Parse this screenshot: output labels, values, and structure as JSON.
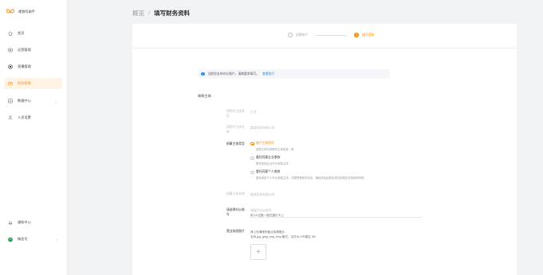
{
  "sidebar": {
    "brand": "视频号助手",
    "items": [
      {
        "label": "首页",
        "icon": "home-icon"
      },
      {
        "label": "运营管理",
        "icon": "ops-icon"
      },
      {
        "label": "直播管理",
        "icon": "live-icon"
      },
      {
        "label": "财务管理",
        "icon": "finance-icon",
        "active": true
      },
      {
        "label": "数据中心",
        "icon": "chart-icon",
        "arrow": "⌄"
      },
      {
        "label": "人员设置",
        "icon": "user-icon"
      }
    ],
    "bottom": [
      {
        "label": "通知中心",
        "icon": "bell-icon"
      },
      {
        "label": "微信号",
        "icon": "avatar-icon",
        "arrow": "›"
      }
    ]
  },
  "breadcrumb": {
    "parent": "概览",
    "separator": "/",
    "current": "填写财务资料"
  },
  "steps": [
    {
      "num": "✓",
      "label": "创建账户"
    },
    {
      "num": "2",
      "label": "填写资料"
    }
  ],
  "tip": {
    "icon": "i",
    "text": "当前仅支持对公账户，请按要求填写。",
    "link": "查看指引"
  },
  "section": {
    "title": "收款主体"
  },
  "rows": {
    "account_type": {
      "label": "视频号主体类型",
      "value": "企业"
    },
    "account_name": {
      "label": "视频号主体名称",
      "value": "某某科技有限公司"
    },
    "settle_type": {
      "label": "结算主体类型"
    },
    "settle_name": {
      "label": "结算主体名称",
      "value": "某某科技有限公司"
    },
    "bank_card": {
      "label": "请选择对公账号",
      "placeholder": "请填写对公账号",
      "sub": "例 18 位数一般在银行卡上"
    },
    "upload": {
      "label": "营业执照图片",
      "hint1": "请上传清晰的营业执照照片",
      "hint2": "支持 jpg, jpeg, png, bmp 格式，文件大小不超过 3M",
      "plus": "+"
    }
  },
  "radios": [
    {
      "title": "账户主体相同",
      "desc": "结算主体与视频号主体信息一致",
      "selected": true
    },
    {
      "title": "委托同意企业收款",
      "desc": "委托其他企业作为收款主体",
      "selected": false
    },
    {
      "title": "委托同意个人收款",
      "desc": "委托其他个人作为收款主体，并需签署相关协议，确保资金结算合规并按规定完成纳税申报",
      "selected": false
    }
  ],
  "colors": {
    "accent": "#ff8a00",
    "link": "#2e8cf0"
  }
}
